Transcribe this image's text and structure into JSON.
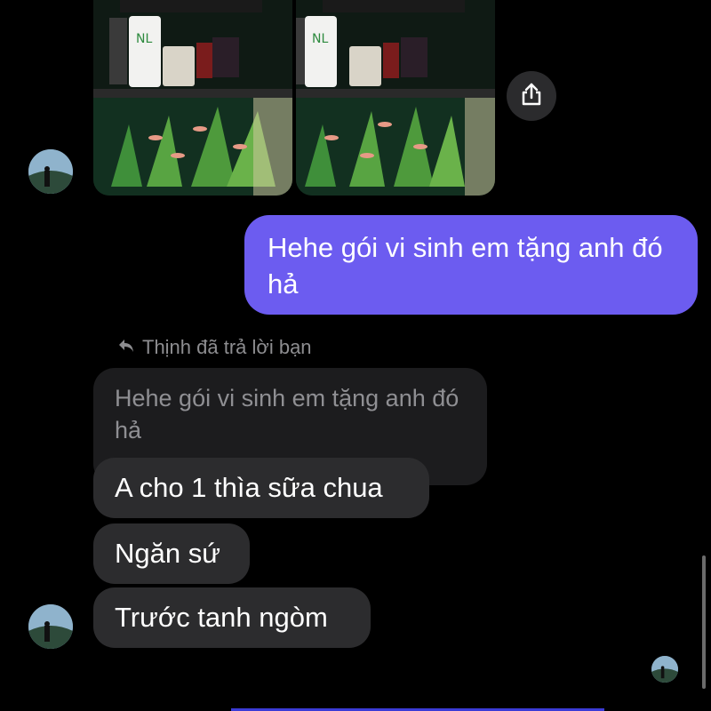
{
  "chat": {
    "outgoing_message": "Hehe gói vi sinh em tặng anh đó hả",
    "reply_label": "Thịnh đã trả lời bạn",
    "quoted_message": "Hehe gói vi sinh em tặng anh đó hả",
    "incoming_messages": [
      "A cho 1 thìa sữa chua",
      "Ngăn sứ",
      "Trước tanh ngòm"
    ]
  },
  "icons": {
    "share": "share-icon",
    "reply": "reply-arrow-icon"
  },
  "colors": {
    "background": "#000000",
    "outgoing_bubble": "#6c5cf0",
    "incoming_bubble": "#2c2c2e",
    "quoted_bubble": "#1c1c1e",
    "muted_text": "#8d8d90"
  }
}
